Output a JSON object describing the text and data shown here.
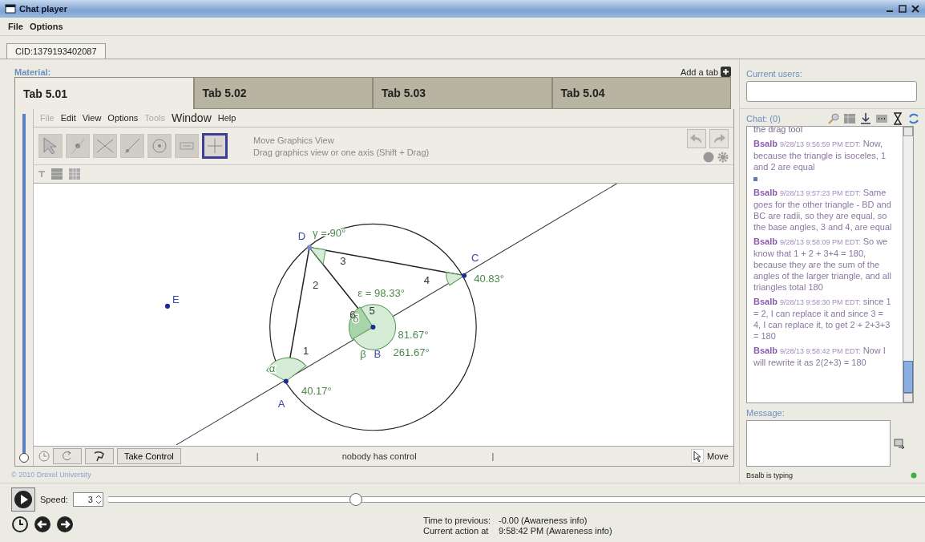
{
  "window": {
    "title": "Chat player"
  },
  "menu": [
    "File",
    "Options"
  ],
  "session_tab": {
    "label": "CID:1379193402087"
  },
  "material": {
    "label": "Material:",
    "add_tab": "Add a tab",
    "tabs": [
      {
        "label": "Tab 5.01",
        "selected": true
      },
      {
        "label": "Tab 5.02",
        "selected": false
      },
      {
        "label": "Tab 5.03",
        "selected": false
      },
      {
        "label": "Tab 5.04",
        "selected": false
      }
    ]
  },
  "geogebra": {
    "menu": [
      {
        "label": "File",
        "disabled": true,
        "emphasized": false
      },
      {
        "label": "Edit",
        "disabled": false,
        "emphasized": false
      },
      {
        "label": "View",
        "disabled": false,
        "emphasized": false
      },
      {
        "label": "Options",
        "disabled": false,
        "emphasized": false
      },
      {
        "label": "Tools",
        "disabled": true,
        "emphasized": false
      },
      {
        "label": "Window",
        "disabled": false,
        "emphasized": true
      },
      {
        "label": "Help",
        "disabled": false,
        "emphasized": false
      }
    ],
    "tools": [
      {
        "selected": false
      },
      {
        "selected": false
      },
      {
        "selected": false
      },
      {
        "selected": false
      },
      {
        "selected": false
      },
      {
        "selected": false
      },
      {
        "selected": true
      }
    ],
    "tool_title": "Move Graphics View",
    "tool_hint": "Drag graphics view or one axis (Shift + Drag)",
    "zoom_slider": {
      "level": 0
    },
    "diagram": {
      "points": [
        {
          "name": "D"
        },
        {
          "name": "C"
        },
        {
          "name": "A"
        },
        {
          "name": "E"
        },
        {
          "name": "B"
        }
      ],
      "angle_labels": [
        "γ = 90°",
        "40.83°",
        "ε = 98.33°",
        "81.67°",
        "261.67°",
        "α",
        "β",
        "δ",
        "40.17°"
      ],
      "segment_labels": [
        "1",
        "2",
        "3",
        "4",
        "5",
        "6"
      ]
    },
    "take_control": "Take Control",
    "separators": [
      "|",
      "|"
    ],
    "control_status": "nobody has control",
    "mode": "Move"
  },
  "copyright": "© 2010 Drexel University",
  "users": {
    "label": "Current users:"
  },
  "chat": {
    "label": "Chat: (0)",
    "partial_line": "the drag tool",
    "messages": [
      {
        "author": "Bsalb",
        "time": "9/28/13 9:56:59 PM EDT:",
        "text": "Now, because the triangle is isoceles, 1 and 2 are equal"
      },
      {
        "author": "Bsalb",
        "time": "9/28/13 9:57:23 PM EDT:",
        "text": "Same goes for the other triangle - BD and BC are radii, so they are equal, so the base angles, 3 and 4, are equal"
      },
      {
        "author": "Bsalb",
        "time": "9/28/13 9:58:09 PM EDT:",
        "text": "So we know that 1 + 2 + 3+4 = 180, because they are the sum of the angles of the larger triangle, and all triangles total 180"
      },
      {
        "author": "Bsalb",
        "time": "9/28/13 9:58:30 PM EDT:",
        "text": "since 1 = 2, I can replace it and since 3 = 4, I can replace it, to get 2 + 2+3+3 = 180"
      },
      {
        "author": "Bsalb",
        "time": "9/28/13 9:58:42 PM EDT:",
        "text": "Now I will rewrite it as 2(2+3) = 180"
      }
    ],
    "message_label": "Message:",
    "typing": "Bsalb is typing"
  },
  "player": {
    "speed_label": "Speed:",
    "speed": "3",
    "level": 0.3,
    "time_to_previous_label": "Time to previous:",
    "time_to_previous": "-0.00 (Awareness info)",
    "current_action_label": "Current action at",
    "current_action": "9:58:42 PM (Awareness info)"
  }
}
